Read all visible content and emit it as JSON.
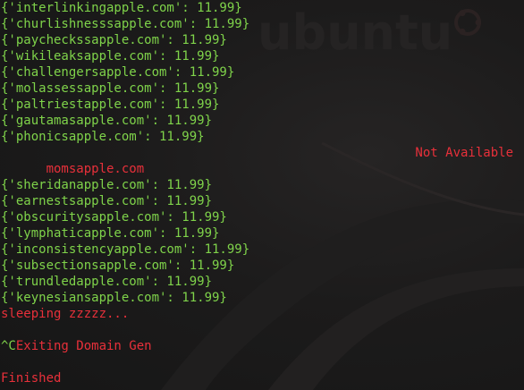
{
  "colors": {
    "green": "#7fd34a",
    "red": "#e8303a",
    "background": "#1b1b1b"
  },
  "wallpaper": {
    "logo_text": "ubuntu"
  },
  "block1": [
    "{'interlinkingapple.com': 11.99}",
    "{'churlishnesssapple.com': 11.99}",
    "{'paycheckssapple.com': 11.99}",
    "{'wikileaksapple.com': 11.99}",
    "{'challengersapple.com': 11.99}",
    "{'molassessapple.com': 11.99}",
    "{'paltriestapple.com': 11.99}",
    "{'gautamasapple.com': 11.99}",
    "{'phonicsapple.com': 11.99}"
  ],
  "unavailable": {
    "domain": "momsapple.com",
    "status": "Not Available"
  },
  "block2": [
    "{'sheridanapple.com': 11.99}",
    "{'earnestsapple.com': 11.99}",
    "{'obscuritysapple.com': 11.99}",
    "{'lymphaticapple.com': 11.99}",
    "{'inconsistencyapple.com': 11.99}",
    "{'subsectionsapple.com': 11.99}",
    "{'trundledapple.com': 11.99}",
    "{'keynesiansapple.com': 11.99}"
  ],
  "messages": {
    "sleeping": "sleeping zzzzz...",
    "exiting_prefix": "^C",
    "exiting": "Exiting Domain Gen",
    "finished": "Finished"
  }
}
